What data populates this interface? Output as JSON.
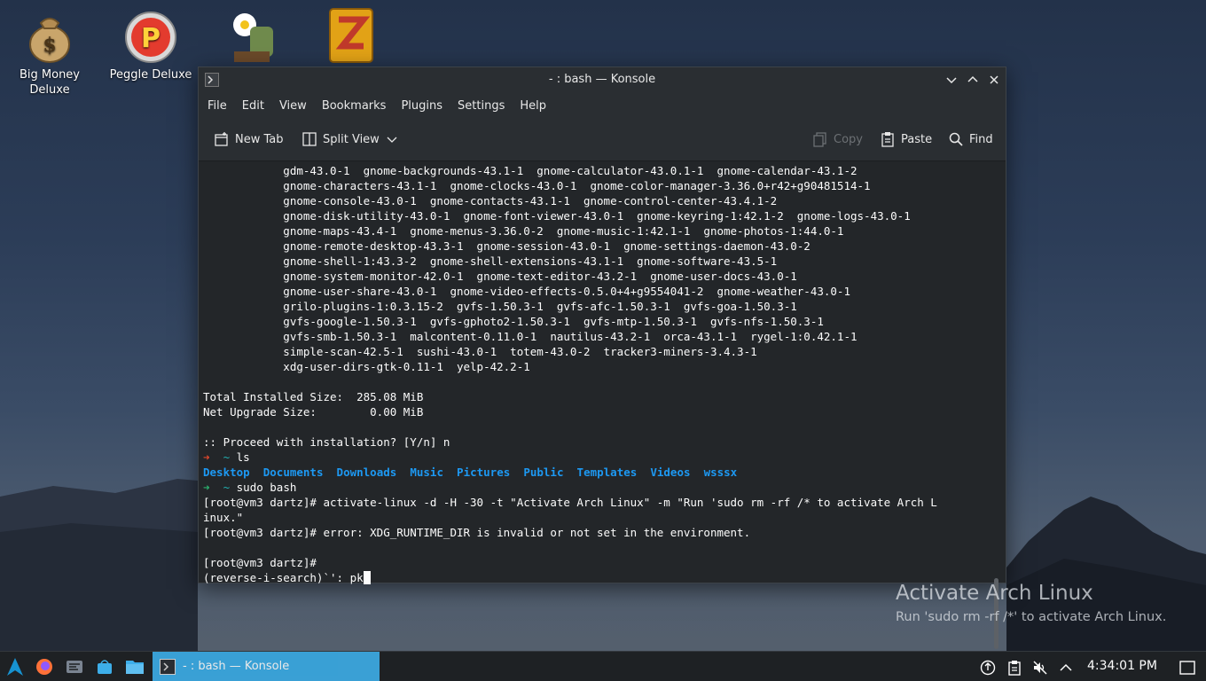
{
  "desktop": {
    "icons": [
      {
        "label": "Big Money Deluxe",
        "icon": "money-bag-icon"
      },
      {
        "label": "Peggle Deluxe",
        "icon": "peggle-icon"
      },
      {
        "label": "",
        "icon": "plants-vs-zombies-icon"
      },
      {
        "label": "",
        "icon": "zuma-icon"
      }
    ]
  },
  "window": {
    "title": "- : bash — Konsole",
    "menu": [
      "File",
      "Edit",
      "View",
      "Bookmarks",
      "Plugins",
      "Settings",
      "Help"
    ],
    "toolbar": {
      "new_tab": "New Tab",
      "split_view": "Split View",
      "copy": "Copy",
      "paste": "Paste",
      "find": "Find"
    }
  },
  "terminal": {
    "packages": [
      "            gdm-43.0-1  gnome-backgrounds-43.1-1  gnome-calculator-43.0.1-1  gnome-calendar-43.1-2",
      "            gnome-characters-43.1-1  gnome-clocks-43.0-1  gnome-color-manager-3.36.0+r42+g90481514-1",
      "            gnome-console-43.0-1  gnome-contacts-43.1-1  gnome-control-center-43.4.1-2",
      "            gnome-disk-utility-43.0-1  gnome-font-viewer-43.0-1  gnome-keyring-1:42.1-2  gnome-logs-43.0-1",
      "            gnome-maps-43.4-1  gnome-menus-3.36.0-2  gnome-music-1:42.1-1  gnome-photos-1:44.0-1",
      "            gnome-remote-desktop-43.3-1  gnome-session-43.0-1  gnome-settings-daemon-43.0-2",
      "            gnome-shell-1:43.3-2  gnome-shell-extensions-43.1-1  gnome-software-43.5-1",
      "            gnome-system-monitor-42.0-1  gnome-text-editor-43.2-1  gnome-user-docs-43.0-1",
      "            gnome-user-share-43.0-1  gnome-video-effects-0.5.0+4+g9554041-2  gnome-weather-43.0-1",
      "            grilo-plugins-1:0.3.15-2  gvfs-1.50.3-1  gvfs-afc-1.50.3-1  gvfs-goa-1.50.3-1",
      "            gvfs-google-1.50.3-1  gvfs-gphoto2-1.50.3-1  gvfs-mtp-1.50.3-1  gvfs-nfs-1.50.3-1",
      "            gvfs-smb-1.50.3-1  malcontent-0.11.0-1  nautilus-43.2-1  orca-43.1-1  rygel-1:0.42.1-1",
      "            simple-scan-42.5-1  sushi-43.0-1  totem-43.0-2  tracker3-miners-3.4.3-1",
      "            xdg-user-dirs-gtk-0.11-1  yelp-42.2-1"
    ],
    "total_installed": "Total Installed Size:  285.08 MiB",
    "net_upgrade": "Net Upgrade Size:        0.00 MiB",
    "proceed": ":: Proceed with installation? [Y/n] n",
    "prompt_arrow": "➜",
    "prompt_tilde": "~",
    "cmd_ls": "ls",
    "ls_output": [
      "Desktop",
      "Documents",
      "Downloads",
      "Music",
      "Pictures",
      "Public",
      "Templates",
      "Videos",
      "wsssx"
    ],
    "cmd_sudo": "sudo bash",
    "root_cmd_1a": "[root@vm3 dartz]# activate-linux -d -H -30 -t \"Activate Arch Linux\" -m \"Run 'sudo rm -rf /* to activate Arch L",
    "root_cmd_1b": "inux.\"",
    "root_err": "[root@vm3 dartz]# error: XDG_RUNTIME_DIR is invalid or not set in the environment.",
    "root_prompt": "[root@vm3 dartz]#",
    "reverse_search": "(reverse-i-search)`': pk"
  },
  "watermark": {
    "title": "Activate Arch Linux",
    "text": "Run 'sudo rm -rf /*' to activate Arch Linux."
  },
  "taskbar": {
    "task_title": "- : bash — Konsole",
    "clock": "4:34:01 PM"
  },
  "colors": {
    "accent": "#3daee9",
    "terminal_bg": "#232629",
    "dir_blue": "#1d99f3",
    "prompt_red": "#e1472c",
    "prompt_green": "#2bb16f"
  }
}
